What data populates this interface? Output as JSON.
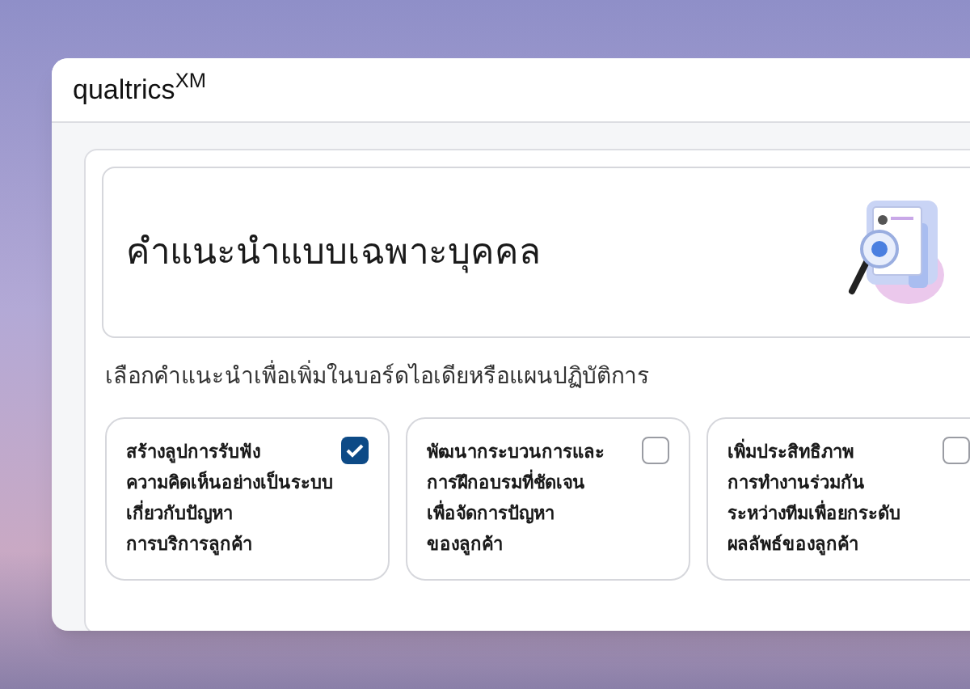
{
  "window": {
    "logo": "qualtrics$^{XM}$"
  },
  "heading": "คำแนะนำแบบเฉพาะบุคคล",
  "instruction": "เลือกคำแนะนำเพื่อเพิ่มในบอร์ดไอเดียหรือแผนปฏิบัติการ",
  "options": [
    {
      "lines": [
        "สร้างลูปการรับฟัง",
        "ความคิดเห็นอย่างเป็นระบบ",
        "เกี่ยวกับปัญหา",
        "การบริการลูกค้า"
      ],
      "checked": true
    },
    {
      "lines": [
        "พัฒนากระบวนการและ",
        "การฝึกอบรมที่ชัดเจน",
        "เพื่อจัดการปัญหา",
        "ของลูกค้า"
      ],
      "checked": false
    },
    {
      "lines": [
        "เพิ่มประสิทธิภาพ",
        "การทำงานร่วมกัน",
        "ระหว่างทีมเพื่อยกระดับ",
        "ผลลัพธ์ของลูกค้า"
      ],
      "checked": false
    }
  ]
}
